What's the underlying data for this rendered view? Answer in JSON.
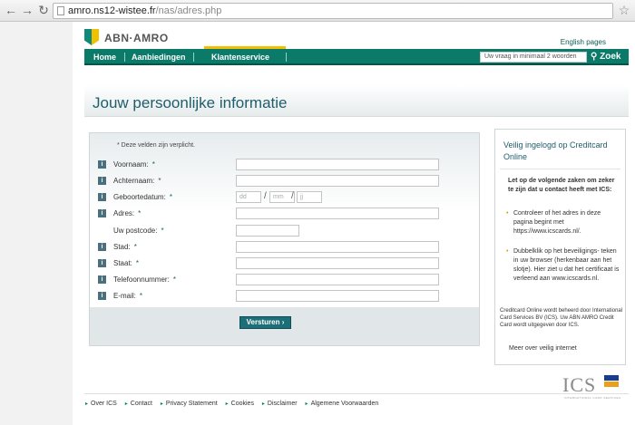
{
  "browser": {
    "url_host": "amro.ns12-wistee.fr",
    "url_path": "/nas/adres.php"
  },
  "header": {
    "logo_text": "ABN·AMRO",
    "english_link": "English pages",
    "nav": [
      "Home",
      "Aanbiedingen",
      "Klantenservice"
    ],
    "search_placeholder": "Uw vraag in minimaal 2 woorden",
    "search_button": "Zoek"
  },
  "page_title": "Jouw persoonlijke informatie",
  "form": {
    "required_note": "* Deze velden zijn verplicht.",
    "fields": [
      {
        "label": "Voornaam:",
        "required": "*"
      },
      {
        "label": "Achternaam:",
        "required": "*"
      },
      {
        "label": "Geboortedatum:",
        "required": "*",
        "placeholders": [
          "dd",
          "mm",
          "jj"
        ]
      },
      {
        "label": "Adres:",
        "required": "*"
      },
      {
        "label": "Uw postcode:",
        "required": "*"
      },
      {
        "label": "Stad:",
        "required": "*"
      },
      {
        "label": "Staat:",
        "required": "*"
      },
      {
        "label": "Telefoonnummer:",
        "required": "*"
      },
      {
        "label": "E-mail:",
        "required": "*"
      }
    ],
    "submit": "Versturen ›"
  },
  "sidebar": {
    "title": "Veilig ingelogd op Creditcard Online",
    "intro": "Let op de volgende zaken om zeker te zijn dat u contact heeft met ICS:",
    "bullets": [
      "Controleer of het adres in deze pagina begint met https://www.icscards.nl/.",
      "Dubbelklik op het beveiligings- teken in uw browser (herkenbaar aan het slotje). Hier ziet u dat het certificaat is verleend aan www.icscards.nl."
    ],
    "small_text": "Creditcard Online wordt beheerd door International Card Services BV (ICS). Uw ABN AMRO Credit Card wordt uitgegeven door ICS.",
    "link": "Meer over veilig internet"
  },
  "footer": {
    "links": [
      "Over ICS",
      "Contact",
      "Privacy Statement",
      "Cookies",
      "Disclaimer",
      "Algemene Voorwaarden"
    ]
  },
  "ics_logo": {
    "text": "ICS",
    "tagline": "INTERNATIONAL CARD SERVICES"
  }
}
